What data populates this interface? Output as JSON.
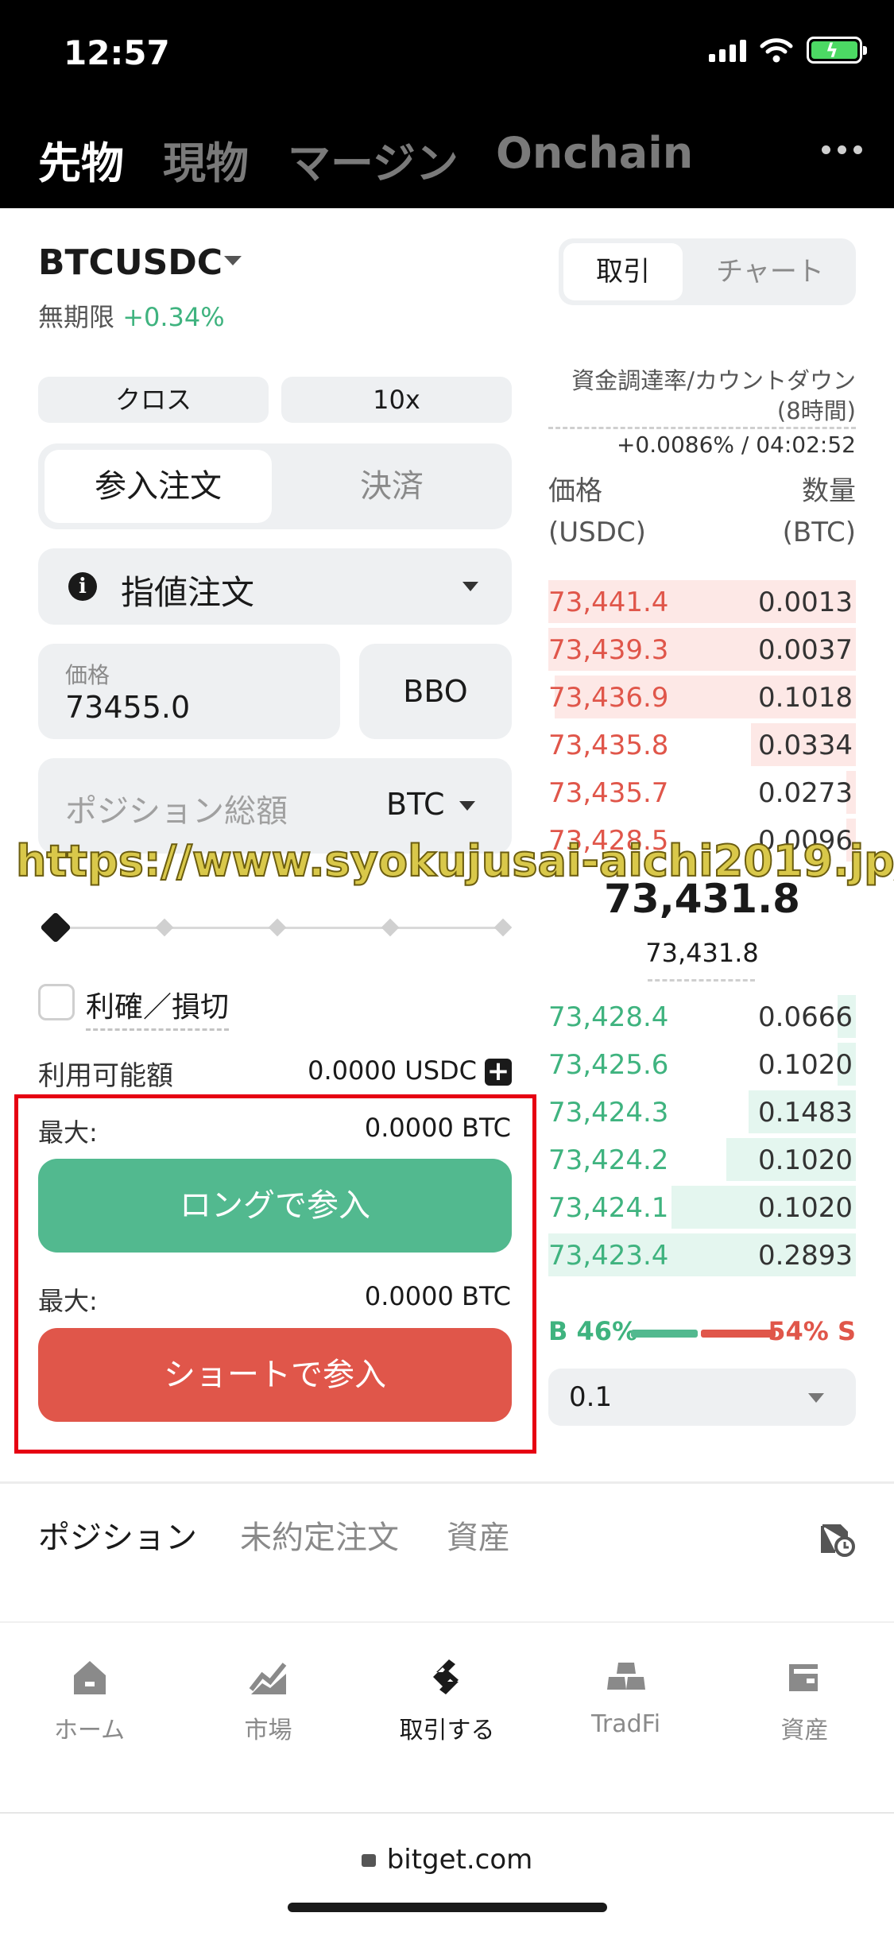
{
  "status_bar": {
    "time": "12:57"
  },
  "top_nav": {
    "tabs": [
      "先物",
      "現物",
      "マージン",
      "Onchain"
    ],
    "active": "先物"
  },
  "pair": {
    "symbol": "BTCUSDC",
    "type": "無期限",
    "change": "+0.34%"
  },
  "view_toggle": {
    "options": [
      "取引",
      "チャート"
    ],
    "active": "取引"
  },
  "form": {
    "margin_mode": "クロス",
    "leverage": "10x",
    "segments": [
      "参入注文",
      "決済"
    ],
    "order_type": "指値注文",
    "price_caption": "価格",
    "price_value": "73455.0",
    "bbo": "BBO",
    "amount_placeholder": "ポジション総額",
    "amount_unit": "BTC",
    "slider_percent": 0,
    "tpsl_label": "利確／損切",
    "available_label": "利用可能額",
    "available_value": "0.0000 USDC",
    "long": {
      "max_label": "最大:",
      "max_value": "0.0000 BTC",
      "button": "ロングで参入"
    },
    "short": {
      "max_label": "最大:",
      "max_value": "0.0000 BTC",
      "button": "ショートで参入"
    }
  },
  "orderbook": {
    "funding_label": "資金調達率/カウントダウン",
    "funding_interval": "(8時間)",
    "funding_value": "+0.0086% / 04:02:52",
    "price_header": [
      "価格",
      "(USDC)"
    ],
    "qty_header": [
      "数量",
      "(BTC)"
    ],
    "asks": [
      {
        "price": "73,441.4",
        "qty": "0.0013",
        "depth": 1.0
      },
      {
        "price": "73,439.3",
        "qty": "0.0037",
        "depth": 1.0
      },
      {
        "price": "73,436.9",
        "qty": "0.1018",
        "depth": 0.98
      },
      {
        "price": "73,435.8",
        "qty": "0.0334",
        "depth": 0.34
      },
      {
        "price": "73,435.7",
        "qty": "0.0273",
        "depth": 0.03
      },
      {
        "price": "73,428.5",
        "qty": "0.0096",
        "depth": 0.03
      }
    ],
    "mid_price": "73,431.8",
    "mark_price": "73,431.8",
    "bids": [
      {
        "price": "73,428.4",
        "qty": "0.0666",
        "depth": 0.06
      },
      {
        "price": "73,425.6",
        "qty": "0.1020",
        "depth": 0.06
      },
      {
        "price": "73,424.3",
        "qty": "0.1483",
        "depth": 0.35
      },
      {
        "price": "73,424.2",
        "qty": "0.1020",
        "depth": 0.42
      },
      {
        "price": "73,424.1",
        "qty": "0.1020",
        "depth": 0.6
      },
      {
        "price": "73,423.4",
        "qty": "0.2893",
        "depth": 1.0
      }
    ],
    "buy_ratio": "B 46%",
    "sell_ratio": "54% S",
    "depth_step": "0.1"
  },
  "bottom_tabs": {
    "tabs": [
      "ポジション",
      "未約定注文",
      "資産"
    ],
    "active": "ポジション"
  },
  "tabbar": {
    "items": [
      {
        "label": "ホーム",
        "icon": "home-icon"
      },
      {
        "label": "市場",
        "icon": "market-icon"
      },
      {
        "label": "取引する",
        "icon": "trade-icon"
      },
      {
        "label": "TradFi",
        "icon": "tradfi-icon"
      },
      {
        "label": "資産",
        "icon": "wallet-icon"
      }
    ],
    "active": "取引する"
  },
  "browser": {
    "url": "bitget.com"
  },
  "watermark": "https://www.syokujusai-aichi2019.jp/",
  "colors": {
    "buy": "#52b98f",
    "sell": "#e0564a",
    "highlight": "#e60012"
  }
}
